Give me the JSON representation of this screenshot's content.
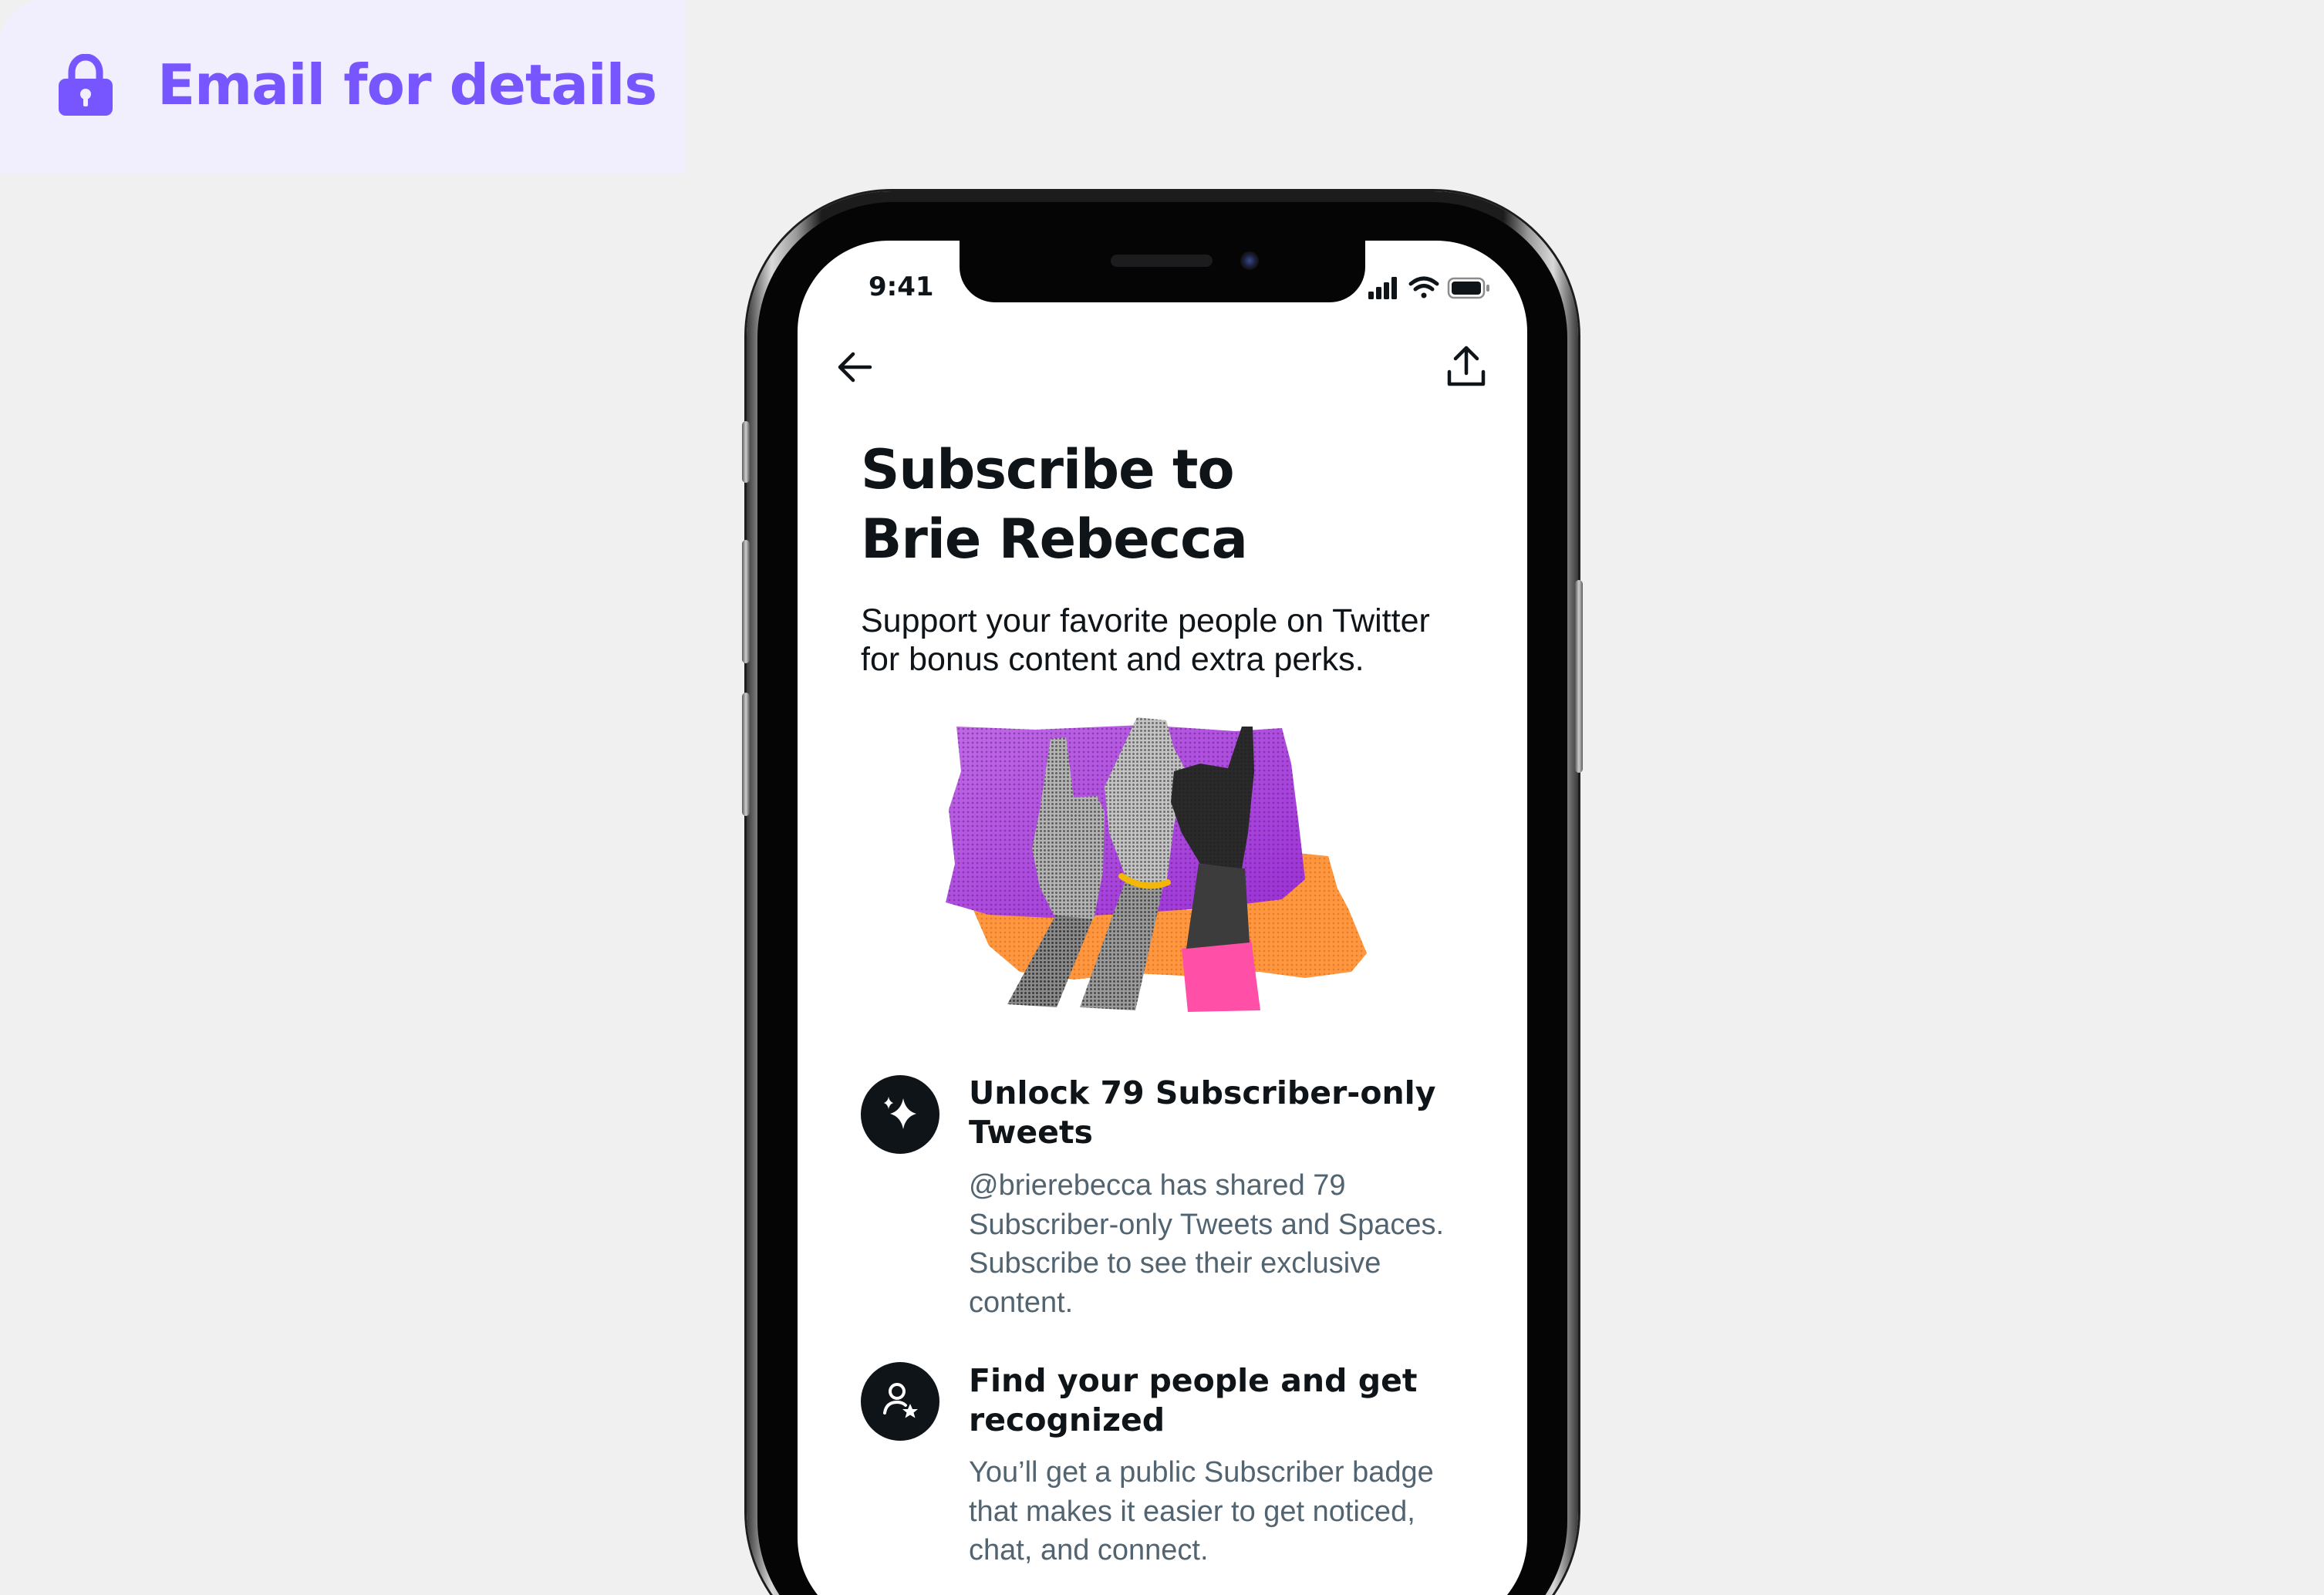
{
  "badge": {
    "text": "Email for details",
    "icon": "lock-icon",
    "color": "#7856ff"
  },
  "status_bar": {
    "time": "9:41",
    "icons": [
      "cellular-signal-icon",
      "wifi-icon",
      "battery-icon"
    ]
  },
  "nav": {
    "back_icon": "arrow-left-icon",
    "share_icon": "share-icon"
  },
  "page": {
    "title_line1": "Subscribe to",
    "title_line2": "Brie Rebecca",
    "subtitle_line1": "Support your favorite people on Twitter",
    "subtitle_line2": "for bonus content and extra perks."
  },
  "features": [
    {
      "icon": "sparkle-icon",
      "title_line1": "Unlock 79 Subscriber-only",
      "title_line2": "Tweets",
      "desc_lines": [
        "@brierebecca has shared 79",
        "Subscriber-only Tweets and Spaces.",
        "Subscribe to see their exclusive",
        "content."
      ]
    },
    {
      "icon": "person-star-icon",
      "title_line1": "Find your people and get",
      "title_line2": "recognized",
      "desc_lines": [
        "You’ll get a public Subscriber badge",
        "that makes it easier to get noticed,",
        "chat, and connect."
      ]
    }
  ],
  "colors": {
    "text_primary": "#0f1419",
    "text_secondary": "#536471",
    "badge_background": "#f1eefe",
    "page_background": "#f0f0f0"
  }
}
